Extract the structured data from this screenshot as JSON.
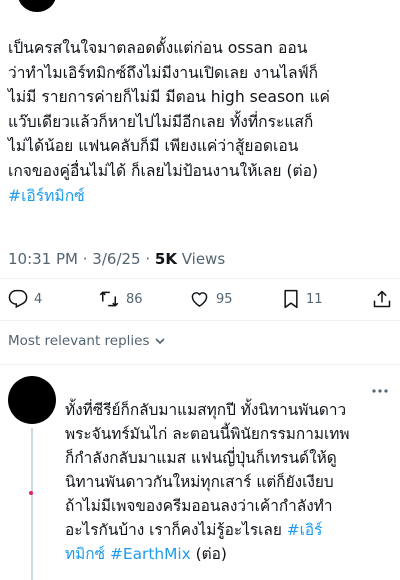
{
  "tweet": {
    "lines": [
      "เป็นครสในใจมาตลอดตั้งแต่ก่อน ossan ออน",
      "ว่าทำไมเอิร์ทมิกซ์ถึงไม่มีงานเปิดเลย งานไลฟ์ก็",
      "ไม่มี รายการค่ายก็ไม่มี มีตอน high season แค่",
      "แว๊บเดียวแล้วก็หายไปไม่มีอีกเลย ทั้งที่กระแสก็",
      "ไม่ได้น้อย แฟนคลับก็มี เพียงแค่ว่าสู้ยอดเอน",
      "เกจของคู่อื่นไม่ได้ ก็เลยไม่ป้อนงานให้เลย (ต่อ)"
    ],
    "hashtag": "#เอิร์ทมิกซ์",
    "time": "10:31 PM",
    "sep": " · ",
    "date": "3/6/25",
    "views_count": "5K",
    "views_label": " Views"
  },
  "actions": {
    "reply_count": "4",
    "retweet_count": "86",
    "like_count": "95",
    "bookmark_count": "11"
  },
  "sort_label": "Most relevant replies",
  "reply": {
    "lines": [
      "ทั้งที่ซีรีย์ก็กลับมาแมสทุกปี ทั้งนิทานพันดาว",
      "พระจันทร์มันไก่ ละตอนนี้พินัยกรรมกามเทพ",
      "ก็กำลังกลับมาแมส แฟนญี่ปุ่นก็เทรนด์ให้ดู",
      "นิทานพันดาวกันใหม่ทุกเสาร์ แต่ก็ยังเงียบ",
      "ถ้าไม่มีเพจของครีมออนลงว่าเค้ากำลังทำ"
    ],
    "last_line_text": "อะไรกันบ้าง เราก็คงไม่รู้อะไรเลย ",
    "hashtag1": "#เอิร์",
    "hashtag2": "ทมิกซ์ #EarthMix",
    "suffix": " (ต่อ)"
  },
  "colors": {
    "link": "#1d9bf0",
    "muted": "#536471",
    "text": "#0f1419"
  }
}
